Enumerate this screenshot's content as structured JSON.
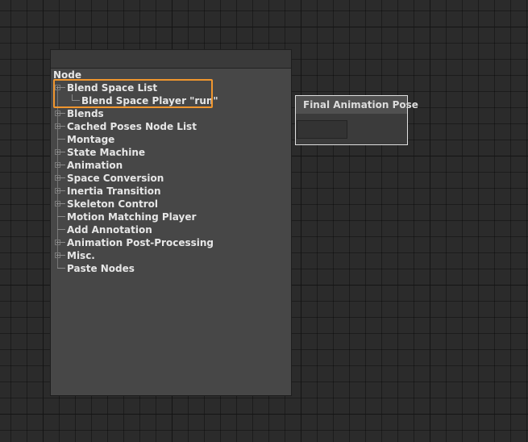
{
  "context_menu": {
    "title": "Node",
    "items": [
      {
        "label": "Blend Space List",
        "expandable": true
      },
      {
        "label": "Blend Space Player \"run\"",
        "child": true
      },
      {
        "label": "Blends",
        "expandable": true
      },
      {
        "label": "Cached Poses Node List",
        "expandable": true
      },
      {
        "label": "Montage",
        "expandable": false
      },
      {
        "label": "State Machine",
        "expandable": true
      },
      {
        "label": "Animation",
        "expandable": true
      },
      {
        "label": "Space Conversion",
        "expandable": true
      },
      {
        "label": "Inertia Transition",
        "expandable": true
      },
      {
        "label": "Skeleton Control",
        "expandable": true
      },
      {
        "label": "Motion Matching Player",
        "expandable": false
      },
      {
        "label": "Add Annotation",
        "expandable": false
      },
      {
        "label": "Animation Post-Processing",
        "expandable": true
      },
      {
        "label": "Misc.",
        "expandable": true
      },
      {
        "label": "Paste Nodes",
        "expandable": false
      }
    ]
  },
  "graph_node": {
    "title": "Final Animation Pose"
  },
  "colors": {
    "highlight": "#f0962e",
    "menu_bg": "#474747",
    "canvas_bg": "#2b2b2b"
  }
}
